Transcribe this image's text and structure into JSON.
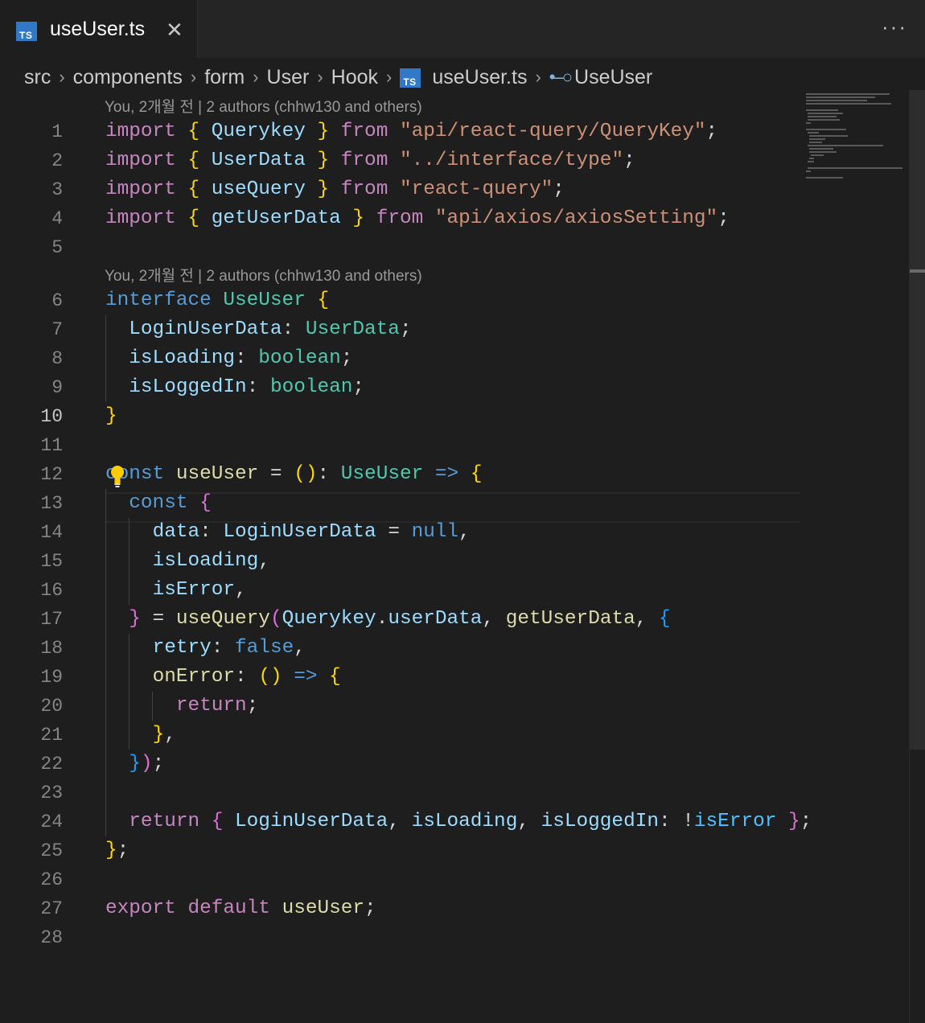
{
  "tab": {
    "icon": "typescript-file-icon",
    "badge": "TS",
    "label": "useUser.ts",
    "close": "✕"
  },
  "more_actions": "···",
  "breadcrumb": {
    "items": [
      "src",
      "components",
      "form",
      "User",
      "Hook"
    ],
    "file_badge": "TS",
    "file": "useUser.ts",
    "symbol_icon": "interface-symbol-icon",
    "symbol": "UseUser"
  },
  "code_lens": [
    "You, 2개월 전 | 2 authors (chhw130 and others)",
    "You, 2개월 전 | 2 authors (chhw130 and others)"
  ],
  "editor": {
    "active_line": "10",
    "lines": [
      {
        "n": "1",
        "tokens": [
          {
            "t": "import",
            "c": "kw"
          },
          {
            "t": " "
          },
          {
            "t": "{",
            "c": "b1"
          },
          {
            "t": " "
          },
          {
            "t": "Querykey",
            "c": "var"
          },
          {
            "t": " "
          },
          {
            "t": "}",
            "c": "b1"
          },
          {
            "t": " "
          },
          {
            "t": "from",
            "c": "kw"
          },
          {
            "t": " "
          },
          {
            "t": "\"api/react-query/QueryKey\"",
            "c": "str"
          },
          {
            "t": ";"
          }
        ]
      },
      {
        "n": "2",
        "tokens": [
          {
            "t": "import",
            "c": "kw"
          },
          {
            "t": " "
          },
          {
            "t": "{",
            "c": "b1"
          },
          {
            "t": " "
          },
          {
            "t": "UserData",
            "c": "var"
          },
          {
            "t": " "
          },
          {
            "t": "}",
            "c": "b1"
          },
          {
            "t": " "
          },
          {
            "t": "from",
            "c": "kw"
          },
          {
            "t": " "
          },
          {
            "t": "\"../interface/type\"",
            "c": "str"
          },
          {
            "t": ";"
          }
        ]
      },
      {
        "n": "3",
        "tokens": [
          {
            "t": "import",
            "c": "kw"
          },
          {
            "t": " "
          },
          {
            "t": "{",
            "c": "b1"
          },
          {
            "t": " "
          },
          {
            "t": "useQuery",
            "c": "var"
          },
          {
            "t": " "
          },
          {
            "t": "}",
            "c": "b1"
          },
          {
            "t": " "
          },
          {
            "t": "from",
            "c": "kw"
          },
          {
            "t": " "
          },
          {
            "t": "\"react-query\"",
            "c": "str"
          },
          {
            "t": ";"
          }
        ]
      },
      {
        "n": "4",
        "tokens": [
          {
            "t": "import",
            "c": "kw"
          },
          {
            "t": " "
          },
          {
            "t": "{",
            "c": "b1"
          },
          {
            "t": " "
          },
          {
            "t": "getUserData",
            "c": "var"
          },
          {
            "t": " "
          },
          {
            "t": "}",
            "c": "b1"
          },
          {
            "t": " "
          },
          {
            "t": "from",
            "c": "kw"
          },
          {
            "t": " "
          },
          {
            "t": "\"api/axios/axiosSetting\"",
            "c": "str"
          },
          {
            "t": ";"
          }
        ]
      },
      {
        "n": "5",
        "tokens": []
      },
      {
        "n": "6",
        "tokens": [
          {
            "t": "interface",
            "c": "kwb"
          },
          {
            "t": " "
          },
          {
            "t": "UseUser",
            "c": "type"
          },
          {
            "t": " "
          },
          {
            "t": "{",
            "c": "b1"
          }
        ]
      },
      {
        "n": "7",
        "tokens": [
          {
            "t": "  "
          },
          {
            "t": "LoginUserData",
            "c": "var"
          },
          {
            "t": ": "
          },
          {
            "t": "UserData",
            "c": "type"
          },
          {
            "t": ";"
          }
        ]
      },
      {
        "n": "8",
        "tokens": [
          {
            "t": "  "
          },
          {
            "t": "isLoading",
            "c": "var"
          },
          {
            "t": ": "
          },
          {
            "t": "boolean",
            "c": "type"
          },
          {
            "t": ";"
          }
        ]
      },
      {
        "n": "9",
        "tokens": [
          {
            "t": "  "
          },
          {
            "t": "isLoggedIn",
            "c": "var"
          },
          {
            "t": ": "
          },
          {
            "t": "boolean",
            "c": "type"
          },
          {
            "t": ";"
          }
        ]
      },
      {
        "n": "10",
        "tokens": [
          {
            "t": "}",
            "c": "b1"
          }
        ]
      },
      {
        "n": "11",
        "tokens": []
      },
      {
        "n": "12",
        "tokens": [
          {
            "t": "const",
            "c": "kwb"
          },
          {
            "t": " "
          },
          {
            "t": "useUser",
            "c": "fn"
          },
          {
            "t": " = "
          },
          {
            "t": "()",
            "c": "b1"
          },
          {
            "t": ": "
          },
          {
            "t": "UseUser",
            "c": "type"
          },
          {
            "t": " "
          },
          {
            "t": "=>",
            "c": "kwb"
          },
          {
            "t": " "
          },
          {
            "t": "{",
            "c": "b1"
          }
        ]
      },
      {
        "n": "13",
        "tokens": [
          {
            "t": "  "
          },
          {
            "t": "const",
            "c": "kwb"
          },
          {
            "t": " "
          },
          {
            "t": "{",
            "c": "b2"
          }
        ]
      },
      {
        "n": "14",
        "tokens": [
          {
            "t": "    "
          },
          {
            "t": "data",
            "c": "var"
          },
          {
            "t": ": "
          },
          {
            "t": "LoginUserData",
            "c": "var"
          },
          {
            "t": " = "
          },
          {
            "t": "null",
            "c": "kwb"
          },
          {
            "t": ","
          }
        ]
      },
      {
        "n": "15",
        "tokens": [
          {
            "t": "    "
          },
          {
            "t": "isLoading",
            "c": "var"
          },
          {
            "t": ","
          }
        ]
      },
      {
        "n": "16",
        "tokens": [
          {
            "t": "    "
          },
          {
            "t": "isError",
            "c": "var"
          },
          {
            "t": ","
          }
        ]
      },
      {
        "n": "17",
        "tokens": [
          {
            "t": "  "
          },
          {
            "t": "}",
            "c": "b2"
          },
          {
            "t": " = "
          },
          {
            "t": "useQuery",
            "c": "fn"
          },
          {
            "t": "(",
            "c": "b2"
          },
          {
            "t": "Querykey",
            "c": "var"
          },
          {
            "t": "."
          },
          {
            "t": "userData",
            "c": "var"
          },
          {
            "t": ", "
          },
          {
            "t": "getUserData",
            "c": "fn"
          },
          {
            "t": ", "
          },
          {
            "t": "{",
            "c": "b3"
          }
        ]
      },
      {
        "n": "18",
        "tokens": [
          {
            "t": "    "
          },
          {
            "t": "retry",
            "c": "var"
          },
          {
            "t": ": "
          },
          {
            "t": "false",
            "c": "kwb"
          },
          {
            "t": ","
          }
        ]
      },
      {
        "n": "19",
        "tokens": [
          {
            "t": "    "
          },
          {
            "t": "onError",
            "c": "fn"
          },
          {
            "t": ": "
          },
          {
            "t": "()",
            "c": "b1"
          },
          {
            "t": " "
          },
          {
            "t": "=>",
            "c": "kwb"
          },
          {
            "t": " "
          },
          {
            "t": "{",
            "c": "b1"
          }
        ]
      },
      {
        "n": "20",
        "tokens": [
          {
            "t": "      "
          },
          {
            "t": "return",
            "c": "kw"
          },
          {
            "t": ";"
          }
        ]
      },
      {
        "n": "21",
        "tokens": [
          {
            "t": "    "
          },
          {
            "t": "}",
            "c": "b1"
          },
          {
            "t": ","
          }
        ]
      },
      {
        "n": "22",
        "tokens": [
          {
            "t": "  "
          },
          {
            "t": "}",
            "c": "b3"
          },
          {
            "t": ")",
            "c": "b2"
          },
          {
            "t": ";"
          }
        ]
      },
      {
        "n": "23",
        "tokens": []
      },
      {
        "n": "24",
        "tokens": [
          {
            "t": "  "
          },
          {
            "t": "return",
            "c": "kw"
          },
          {
            "t": " "
          },
          {
            "t": "{",
            "c": "b2"
          },
          {
            "t": " "
          },
          {
            "t": "LoginUserData",
            "c": "var"
          },
          {
            "t": ", "
          },
          {
            "t": "isLoading",
            "c": "var"
          },
          {
            "t": ", "
          },
          {
            "t": "isLoggedIn",
            "c": "var"
          },
          {
            "t": ": !"
          },
          {
            "t": "isError",
            "c": "cnst"
          },
          {
            "t": " "
          },
          {
            "t": "}",
            "c": "b2"
          },
          {
            "t": ";"
          }
        ]
      },
      {
        "n": "25",
        "tokens": [
          {
            "t": "}",
            "c": "b1"
          },
          {
            "t": ";"
          }
        ]
      },
      {
        "n": "26",
        "tokens": []
      },
      {
        "n": "27",
        "tokens": [
          {
            "t": "export",
            "c": "kw"
          },
          {
            "t": " "
          },
          {
            "t": "default",
            "c": "kw"
          },
          {
            "t": " "
          },
          {
            "t": "useUser",
            "c": "fn"
          },
          {
            "t": ";"
          }
        ]
      },
      {
        "n": "28",
        "tokens": []
      }
    ]
  }
}
